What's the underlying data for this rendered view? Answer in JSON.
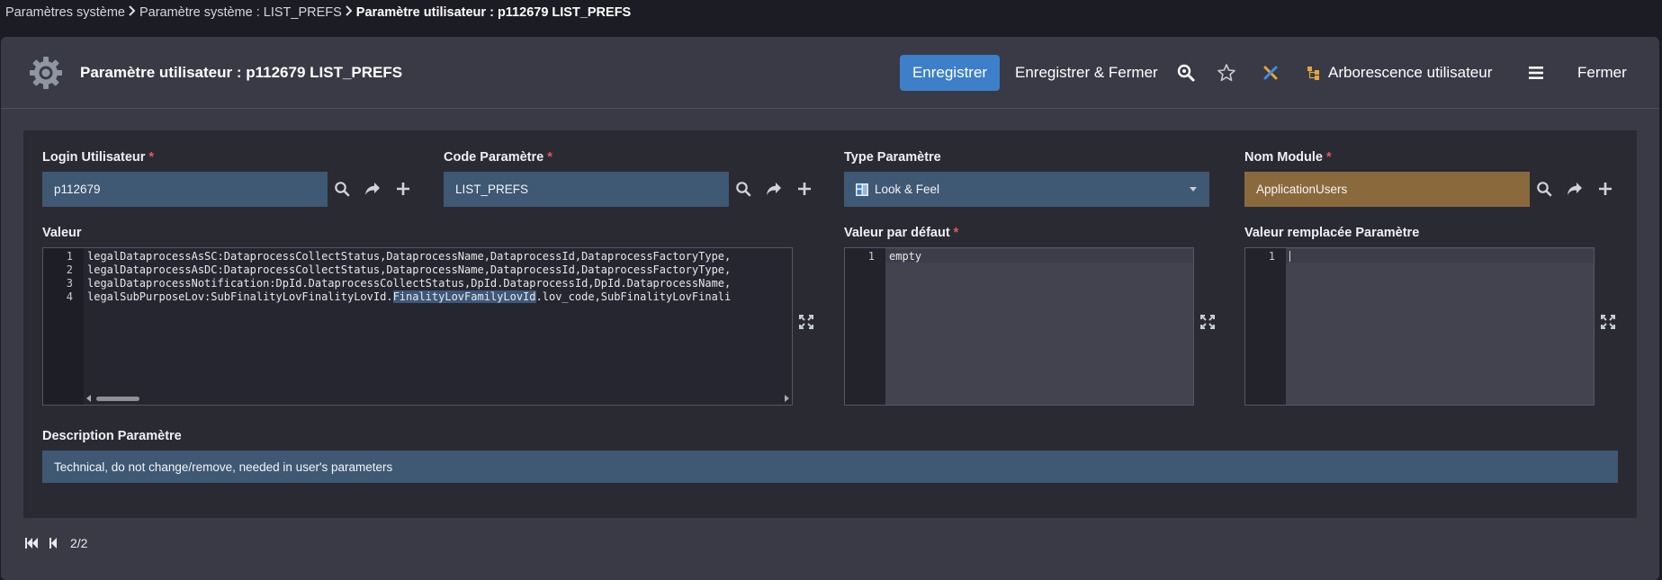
{
  "breadcrumb": {
    "item1": "Paramètres système",
    "item2": "Paramètre système : LIST_PREFS",
    "item3": "Paramètre utilisateur : p112679 LIST_PREFS"
  },
  "header": {
    "title": "Paramètre utilisateur : p112679 LIST_PREFS",
    "icon": "gear-icon"
  },
  "toolbar": {
    "save_label": "Enregistrer",
    "save_close_label": "Enregistrer & Fermer",
    "tree_label": "Arborescence utilisateur",
    "close_label": "Fermer"
  },
  "form": {
    "login": {
      "label": "Login Utilisateur",
      "required": "*",
      "value": "p112679"
    },
    "code": {
      "label": "Code Paramètre",
      "required": "*",
      "value": "LIST_PREFS"
    },
    "type": {
      "label": "Type Paramètre",
      "value": "Look & Feel"
    },
    "module": {
      "label": "Nom Module",
      "required": "*",
      "value": "ApplicationUsers"
    },
    "valeur": {
      "label": "Valeur",
      "line_numbers": [
        "1",
        "2",
        "3",
        "4"
      ],
      "lines": [
        "legalDataprocessAsSC:DataprocessCollectStatus,DataprocessName,DataprocessId,DataprocessFactoryType,",
        "legalDataprocessAsDC:DataprocessCollectStatus,DataprocessName,DataprocessId,DataprocessFactoryType,",
        "legalDataprocessNotification:DpId.DataprocessCollectStatus,DpId.DataprocessId,DpId.DataprocessName,",
        "legalSubPurposeLov:SubFinalityLovFinalityLovId."
      ],
      "line4_highlight": "FinalityLovFamilyLovId",
      "line4_rest": ".lov_code,SubFinalityLovFinali"
    },
    "default_value": {
      "label": "Valeur par défaut",
      "required": "*",
      "line_number": "1",
      "value": "empty"
    },
    "replaced_value": {
      "label": "Valeur remplacée Paramètre",
      "line_number": "1",
      "value": ""
    },
    "description": {
      "label": "Description Paramètre",
      "value": "Technical, do not change/remove, needed in user's parameters"
    }
  },
  "pager": {
    "text": "2/2"
  },
  "colors": {
    "primary": "#3d7fc9",
    "field": "#3f5873",
    "module_field": "#8a6a3c",
    "required": "#e05a5a"
  }
}
